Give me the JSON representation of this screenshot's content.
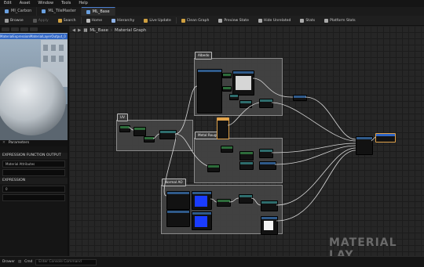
{
  "menubar": [
    "Edit",
    "Asset",
    "Window",
    "Tools",
    "Help"
  ],
  "tabs": [
    {
      "label": "MI_Carbon",
      "active": false
    },
    {
      "label": "ML_TileMaster",
      "active": false
    },
    {
      "label": "ML_Base",
      "active": true
    }
  ],
  "toolbar": [
    {
      "label": "Browse",
      "dim": false,
      "color": "#c8c8c8"
    },
    {
      "label": "Apply",
      "dim": true,
      "color": "#6c6c6c"
    },
    {
      "label": "Search",
      "dim": false,
      "color": "#d0a040"
    },
    {
      "label": "Home",
      "dim": false,
      "color": "#c8c8c8"
    },
    {
      "label": "Hierarchy",
      "dim": false,
      "color": "#8fb3e8"
    },
    {
      "label": "Live Update",
      "dim": false,
      "color": "#d0a040"
    },
    {
      "label": "Clean Graph",
      "dim": false,
      "color": "#c8c8c8"
    },
    {
      "label": "Preview State",
      "dim": false,
      "color": "#c8c8c8"
    },
    {
      "label": "Hide Unrelated",
      "dim": false,
      "color": "#c8c8c8"
    },
    {
      "label": "Stats",
      "dim": false,
      "color": "#c8c8c8"
    },
    {
      "label": "Platform Stats",
      "dim": false,
      "color": "#c8c8c8"
    }
  ],
  "viewport": {
    "selection": "MaterialExpressionMaterialLayerOutput_0"
  },
  "details": {
    "tab_label": "Parameters",
    "section1": "EXPRESSION FUNCTION OUTPUT",
    "field1": "Material Attributes",
    "section2": "EXPRESSION",
    "field2": "0"
  },
  "graph": {
    "breadcrumb_root": "ML_Base",
    "breadcrumb_child": "Material Graph",
    "watermark": "MATERIAL LAY",
    "comments": [
      "Albedo",
      "UV",
      "Metal Roughness",
      "Normal AO"
    ]
  },
  "bottom": {
    "drawer": "Drawer",
    "cmd": "Cmd",
    "cmd_placeholder": "Enter Console Command"
  },
  "colors": {
    "accent": "#2f65c4",
    "node_header_green": "#2d6b3a",
    "node_header_blue": "#2f5a8a",
    "node_header_teal": "#2e6d6d",
    "selected_node": "#e0a24a"
  }
}
